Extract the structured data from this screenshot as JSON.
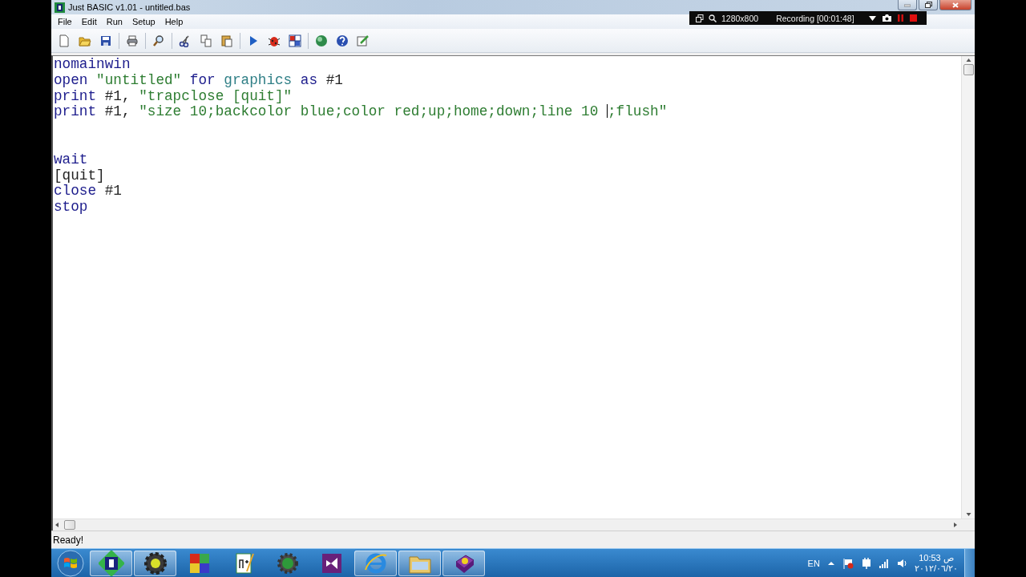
{
  "window": {
    "title": "Just BASIC v1.01 - untitled.bas"
  },
  "menu": [
    "File",
    "Edit",
    "Run",
    "Setup",
    "Help"
  ],
  "recorder": {
    "resolution": "1280x800",
    "status": "Recording [00:01:48]"
  },
  "editor": {
    "lines": [
      {
        "kind": "code",
        "tokens": [
          {
            "kind": "keyword",
            "text": "nomainwin"
          }
        ]
      },
      {
        "kind": "code",
        "tokens": [
          {
            "kind": "keyword",
            "text": "open"
          },
          {
            "kind": "string",
            "text": " \"untitled\""
          },
          {
            "kind": "keyword",
            "text": " for"
          },
          {
            "kind": "type",
            "text": " graphics"
          },
          {
            "kind": "keyword",
            "text": " as"
          },
          {
            "kind": "plain",
            "text": " #1"
          }
        ]
      },
      {
        "kind": "code",
        "tokens": [
          {
            "kind": "keyword",
            "text": "print"
          },
          {
            "kind": "plain",
            "text": " #1, "
          },
          {
            "kind": "string",
            "text": "\"trapclose [quit]\""
          }
        ]
      },
      {
        "kind": "code",
        "tokens": [
          {
            "kind": "keyword",
            "text": "print"
          },
          {
            "kind": "plain",
            "text": " #1, "
          },
          {
            "kind": "string",
            "text": "\"size 10;backcolor blue;color red;up;home;down;line 10 "
          },
          {
            "kind": "caret"
          },
          {
            "kind": "string",
            "text": ";flush\""
          }
        ]
      },
      {
        "kind": "blank"
      },
      {
        "kind": "blank"
      },
      {
        "kind": "code",
        "tokens": [
          {
            "kind": "keyword",
            "text": "wait"
          }
        ]
      },
      {
        "kind": "code",
        "tokens": [
          {
            "kind": "plain",
            "text": "[quit]"
          }
        ]
      },
      {
        "kind": "code",
        "tokens": [
          {
            "kind": "keyword",
            "text": "close"
          },
          {
            "kind": "plain",
            "text": " #1"
          }
        ]
      },
      {
        "kind": "code",
        "tokens": [
          {
            "kind": "keyword",
            "text": "stop"
          }
        ]
      }
    ]
  },
  "status_bar": "Ready!",
  "tray": {
    "language": "EN",
    "time": "10:53 ص",
    "date": "٢٠١٢/٠٦/٢٠"
  }
}
